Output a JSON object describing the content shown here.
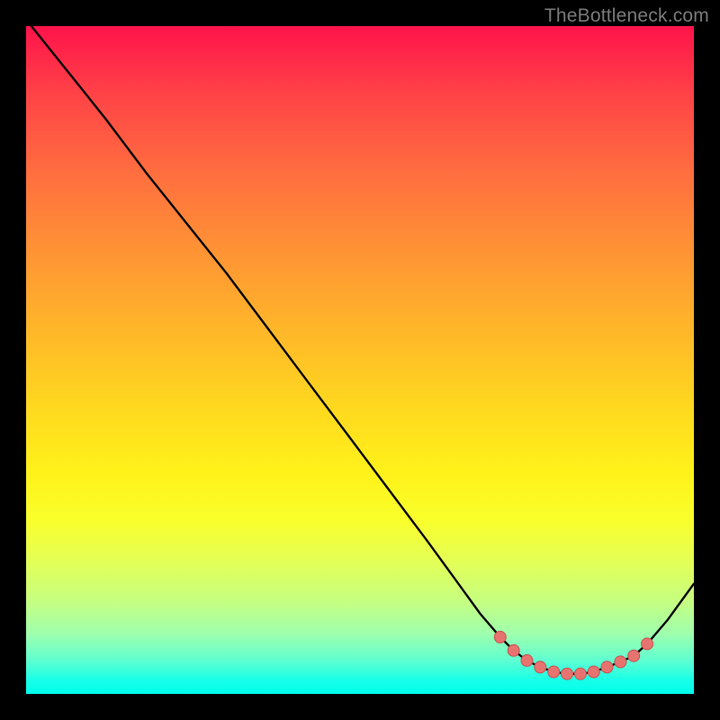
{
  "watermark": "TheBottleneck.com",
  "colors": {
    "line": "#000000",
    "marker_fill": "#e77370",
    "marker_stroke": "#c9524f"
  },
  "chart_data": {
    "type": "line",
    "title": "",
    "xlabel": "",
    "ylabel": "",
    "xlim": [
      0,
      100
    ],
    "ylim": [
      0,
      100
    ],
    "series": [
      {
        "name": "curve",
        "x": [
          0,
          4,
          8,
          12,
          18,
          24,
          30,
          36,
          42,
          48,
          54,
          60,
          64,
          68,
          71,
          73,
          75,
          77,
          79,
          81,
          83,
          85,
          87,
          89,
          91,
          93,
          96,
          100
        ],
        "y": [
          101,
          96,
          91,
          86,
          78,
          70.5,
          63,
          55,
          47,
          39,
          31,
          23,
          17.5,
          12,
          8.5,
          6.5,
          5,
          4,
          3.3,
          3,
          3,
          3.3,
          4,
          4.8,
          5.7,
          7.5,
          11,
          16.5
        ]
      }
    ],
    "markers": {
      "x": [
        71,
        73,
        75,
        77,
        79,
        81,
        83,
        85,
        87,
        89,
        91,
        93
      ],
      "y": [
        8.5,
        6.5,
        5,
        4,
        3.3,
        3,
        3,
        3.3,
        4,
        4.8,
        5.7,
        7.5
      ]
    }
  }
}
